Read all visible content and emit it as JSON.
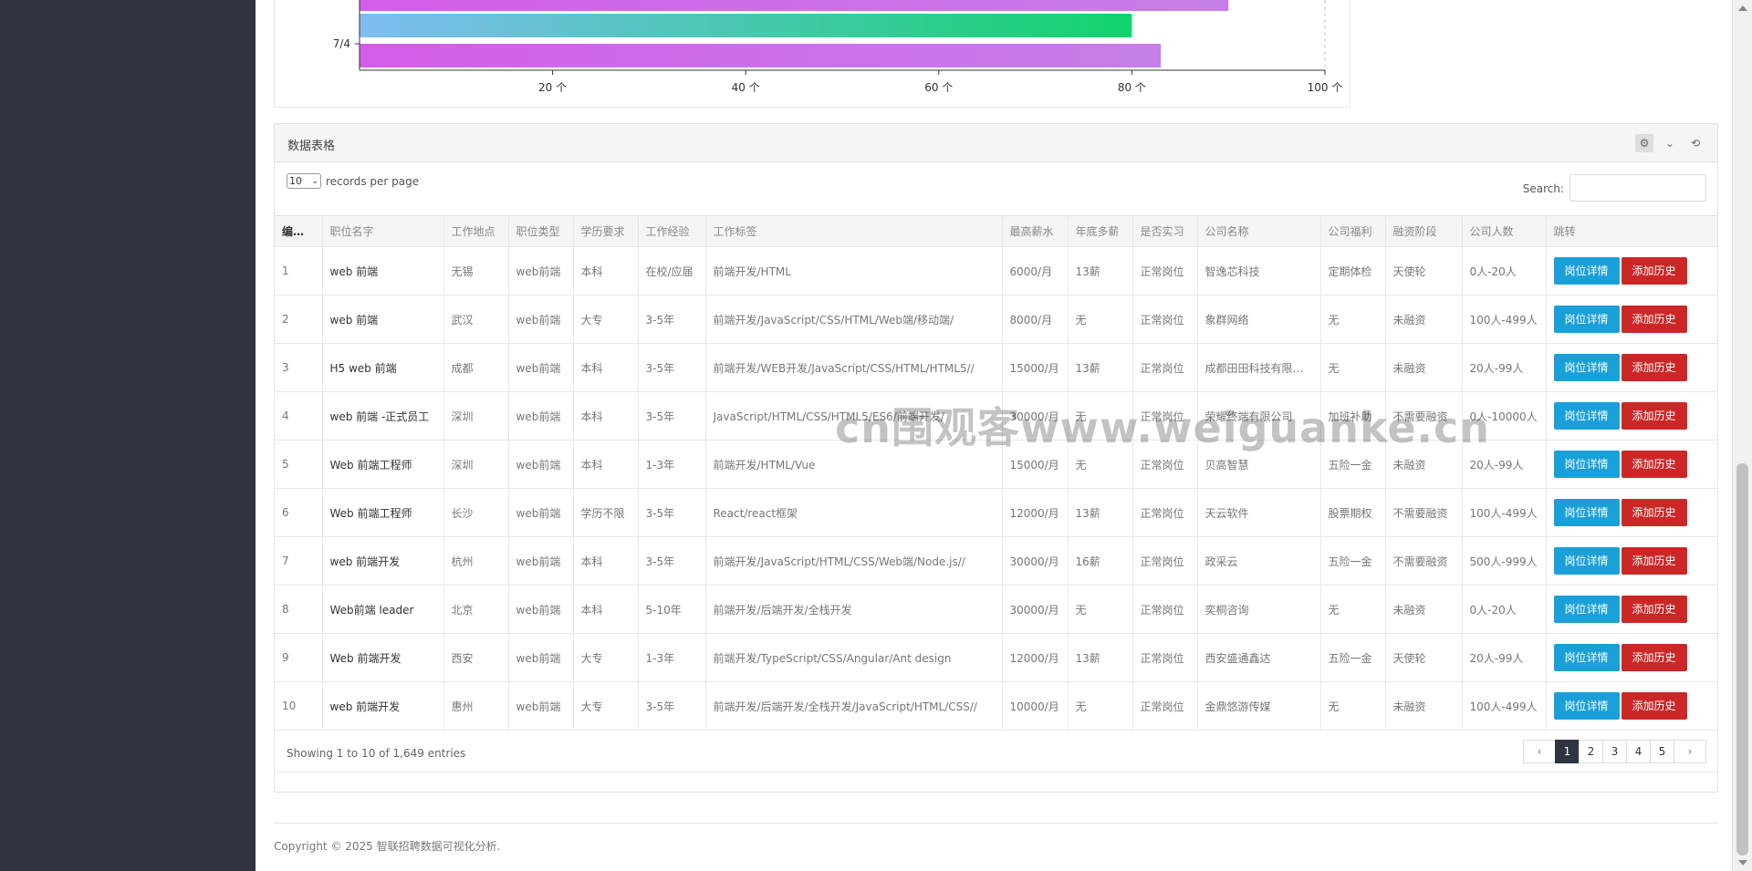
{
  "chart_data": {
    "type": "bar",
    "orientation": "horizontal",
    "categories": [
      "",
      "",
      "7/4"
    ],
    "series": [
      {
        "values": [
          90,
          80,
          83
        ]
      }
    ],
    "xticks": [
      "20 个",
      "40 个",
      "60 个",
      "80 个",
      "100 个"
    ],
    "xlim": [
      0,
      100
    ],
    "colors": {
      "pink": "#d35ee8",
      "gradient_start": "#7fbdf2",
      "gradient_end": "#11d36b"
    }
  },
  "panel": {
    "title": "数据表格",
    "tools": {
      "gear": "gear-icon",
      "collapse": "chevron-down-icon",
      "refresh": "refresh-icon"
    }
  },
  "controls": {
    "length_value": "10",
    "length_label": "records per page",
    "search_label": "Search:",
    "search_value": ""
  },
  "table": {
    "sort_indicator": "^",
    "headers": [
      "编号",
      "职位名字",
      "工作地点",
      "职位类型",
      "学历要求",
      "工作经验",
      "工作标签",
      "最高薪水",
      "年底多薪",
      "是否实习",
      "公司名称",
      "公司福利",
      "融资阶段",
      "公司人数",
      "跳转"
    ],
    "detail_label": "岗位详情",
    "history_label": "添加历史",
    "rows": [
      [
        "1",
        "web 前端",
        "无锡",
        "web前端",
        "本科",
        "在校/应届",
        "前端开发/HTML",
        "6000/月",
        "13薪",
        "正常岗位",
        "智逸芯科技",
        "定期体检",
        "天使轮",
        "0人-20人"
      ],
      [
        "2",
        "web 前端",
        "武汉",
        "web前端",
        "大专",
        "3-5年",
        "前端开发/JavaScript/CSS/HTML/Web端/移动端/",
        "8000/月",
        "无",
        "正常岗位",
        "象群网络",
        "无",
        "未融资",
        "100人-499人"
      ],
      [
        "3",
        "H5 web 前端",
        "成都",
        "web前端",
        "本科",
        "3-5年",
        "前端开发/WEB开发/JavaScript/CSS/HTML/HTML5//",
        "15000/月",
        "13薪",
        "正常岗位",
        "成都田田科技有限公司",
        "无",
        "未融资",
        "20人-99人"
      ],
      [
        "4",
        "web 前端 -正式员工",
        "深圳",
        "web前端",
        "本科",
        "3-5年",
        "JavaScript/HTML/CSS/HTML5/ES6/前端开发/",
        "30000/月",
        "无",
        "正常岗位",
        "荣耀终端有限公司",
        "加班补助",
        "不需要融资",
        "0人-10000人"
      ],
      [
        "5",
        "Web 前端工程师",
        "深圳",
        "web前端",
        "本科",
        "1-3年",
        "前端开发/HTML/Vue",
        "15000/月",
        "无",
        "正常岗位",
        "贝高智慧",
        "五险一金",
        "未融资",
        "20人-99人"
      ],
      [
        "6",
        "Web 前端工程师",
        "长沙",
        "web前端",
        "学历不限",
        "3-5年",
        "React/react框架",
        "12000/月",
        "13薪",
        "正常岗位",
        "天云软件",
        "股票期权",
        "不需要融资",
        "100人-499人"
      ],
      [
        "7",
        "web 前端开发",
        "杭州",
        "web前端",
        "本科",
        "3-5年",
        "前端开发/JavaScript/HTML/CSS/Web端/Node.js//",
        "30000/月",
        "16薪",
        "正常岗位",
        "政采云",
        "五险一金",
        "不需要融资",
        "500人-999人"
      ],
      [
        "8",
        "Web前端 leader",
        "北京",
        "web前端",
        "本科",
        "5-10年",
        "前端开发/后端开发/全栈开发",
        "30000/月",
        "无",
        "正常岗位",
        "奕桐咨询",
        "无",
        "未融资",
        "0人-20人"
      ],
      [
        "9",
        "Web 前端开发",
        "西安",
        "web前端",
        "大专",
        "1-3年",
        "前端开发/TypeScript/CSS/Angular/Ant design",
        "12000/月",
        "13薪",
        "正常岗位",
        "西安盛通鑫达",
        "五险一金",
        "天使轮",
        "20人-99人"
      ],
      [
        "10",
        "web 前端开发",
        "惠州",
        "web前端",
        "大专",
        "3-5年",
        "前端开发/后端开发/全栈开发/JavaScript/HTML/CSS//",
        "10000/月",
        "无",
        "正常岗位",
        "金鼎悠游传媒",
        "无",
        "未融资",
        "100人-499人"
      ]
    ]
  },
  "pagination": {
    "info": "Showing 1 to 10 of 1,649 entries",
    "prev": "‹",
    "pages": [
      "1",
      "2",
      "3",
      "4",
      "5"
    ],
    "next": "›",
    "active": "1"
  },
  "footer": {
    "copyright": "Copyright © 2025 智联招聘数据可视化分析."
  },
  "watermark": "cn围观客www.weiguanke.cn"
}
